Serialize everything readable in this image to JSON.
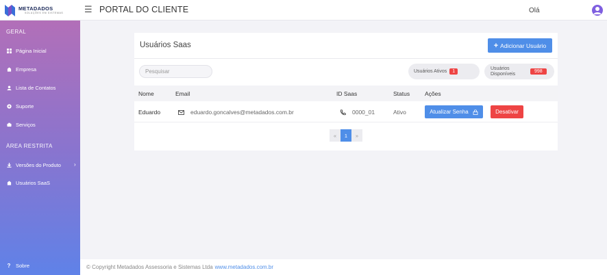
{
  "header": {
    "logo_text": "METADADOS",
    "logo_sub": "SOLUÇÕES EM SISTEMAS",
    "menu_icon": "☰",
    "title": "PORTAL DO CLIENTE",
    "greeting": "Olá"
  },
  "sidebar": {
    "section_general": "GERAL",
    "section_restricted": "ÁREA RESTRITA",
    "items": [
      {
        "label": "Página Inicial",
        "icon": "grid-icon"
      },
      {
        "label": "Empresa",
        "icon": "building-icon"
      },
      {
        "label": "Lista de Contatos",
        "icon": "contacts-icon"
      },
      {
        "label": "Suporte",
        "icon": "support-icon"
      },
      {
        "label": "Serviços",
        "icon": "services-icon"
      },
      {
        "label": "Versões do Produto",
        "icon": "download-icon",
        "chevron": "›"
      },
      {
        "label": "Usuários SaaS",
        "icon": "users-icon"
      }
    ],
    "about_icon": "?",
    "about_label": "Sobre"
  },
  "main": {
    "title": "Usuários Saas",
    "add_button": "Adicionar Usuário",
    "search_placeholder": "Pesquisar",
    "active_users_label": "Usuários Ativos",
    "active_users_count": "1",
    "available_users_label_1": "Usuários",
    "available_users_label_2": "Disponíveis",
    "available_users_count": "998",
    "columns": {
      "name": "Nome",
      "email": "Email",
      "id": "ID Saas",
      "status": "Status",
      "actions": "Ações"
    },
    "rows": [
      {
        "name": "Eduardo",
        "email": "eduardo.goncalves@metadados.com.br",
        "id": "0000_01",
        "status": "Ativo",
        "update_button": "Atualizar Senha",
        "deactivate_button": "Desativar"
      }
    ],
    "pagination": {
      "prev": "«",
      "current": "1",
      "next": "»"
    }
  },
  "footer": {
    "copyright": "© Copyright Metadados Assessoria e Sistemas Ltda",
    "link": "www.metadados.com.br"
  },
  "colors": {
    "primary": "#4f8ee8",
    "danger": "#ee4444",
    "sidebar_top": "#b26fb8",
    "sidebar_bottom": "#5f82e8",
    "avatar": "#7f5fe0"
  }
}
